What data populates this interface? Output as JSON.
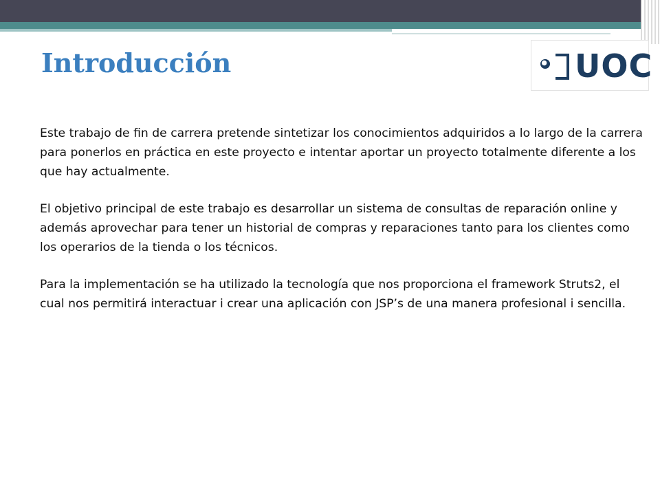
{
  "slide": {
    "title": "Introducción",
    "logo_text": "UOC",
    "paragraphs": [
      "Este trabajo de fin de carrera pretende sintetizar los conocimientos adquiridos a lo largo de la carrera para ponerlos en práctica en este proyecto e intentar aportar un proyecto totalmente diferente a los que hay actualmente.",
      "El objetivo principal de este trabajo es desarrollar un sistema de consultas de reparación online y además aprovechar para tener un historial de compras y reparaciones tanto para los clientes como los operarios de la tienda o los técnicos.",
      "Para la implementación se ha utilizado la tecnología que nos proporciona el framework Struts2, el cual nos permitirá interactuar i crear una aplicación con JSP’s de una manera profesional i sencilla."
    ]
  },
  "colors": {
    "header_dark": "#464655",
    "header_teal": "#4e8c8c",
    "title": "#3b7fbf",
    "logo": "#1d3d60"
  }
}
